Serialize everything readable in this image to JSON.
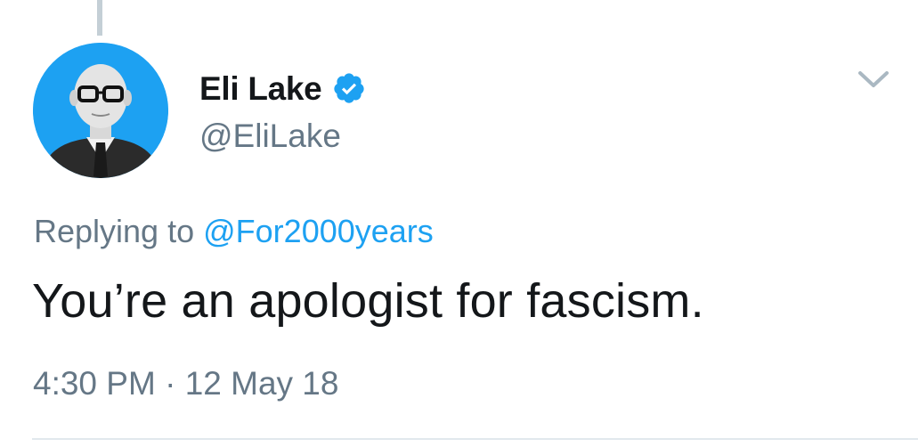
{
  "tweet": {
    "author": {
      "display_name": "Eli Lake",
      "handle": "@EliLake",
      "verified": true
    },
    "reply": {
      "prefix": "Replying to",
      "to_handle": "@For2000years"
    },
    "text": "You’re an apologist for fascism.",
    "time": "4:30 PM",
    "separator": "·",
    "date": "12 May 18"
  },
  "icons": {
    "verified": "verified-badge-icon",
    "menu": "chevron-down-icon"
  },
  "colors": {
    "accent": "#1da1f2",
    "text": "#14171a",
    "secondary": "#657786",
    "divider": "#e1e8ed",
    "thread_line": "#c4cfd6"
  }
}
